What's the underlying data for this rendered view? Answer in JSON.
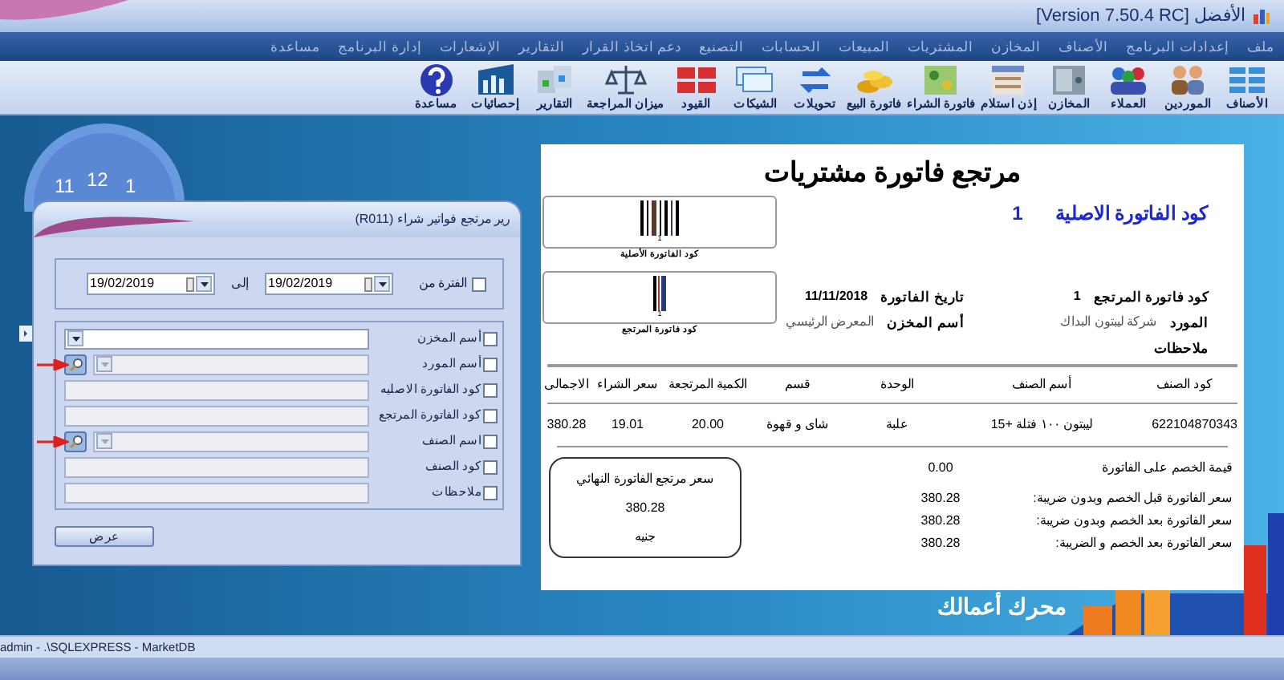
{
  "window": {
    "title": "[Version 7.50.4 RC] الأفضل"
  },
  "menu": [
    "ملف",
    "إعدادات البرنامج",
    "الأصناف",
    "المخازن",
    "المشتريات",
    "المبيعات",
    "الحسابات",
    "التصنيع",
    "دعم اتخاذ القرار",
    "التقارير",
    "الإشعارات",
    "إدارة البرنامج",
    "مساعدة"
  ],
  "toolbar": [
    "الأصناف",
    "الموردين",
    "العملاء",
    "المخازن",
    "إذن استلام",
    "فاتورة الشراء",
    "فاتورة البيع",
    "تحويلات",
    "الشيكات",
    "القيود",
    "ميزان المراجعة",
    "التقارير",
    "إحصائيات",
    "مساعدة"
  ],
  "clock_numbers": [
    "11",
    "12",
    "1"
  ],
  "dialog": {
    "title": "رير مرتجع فواتير شراء  (R011)",
    "period": {
      "label": "الفترة من",
      "checked": false,
      "from": "19/02/2019",
      "to_label": "إلى",
      "to": "19/02/2019"
    },
    "filters": [
      {
        "label": "أسم المخزن",
        "checked": false,
        "kind": "dropdown",
        "marked": false
      },
      {
        "label": "أسم المورد",
        "checked": false,
        "kind": "lookup",
        "marked": true
      },
      {
        "label": "كود الفاتورة الاصليه",
        "checked": false,
        "kind": "text",
        "marked": false
      },
      {
        "label": "كود الفاتورة المرتجع",
        "checked": false,
        "kind": "text",
        "marked": false
      },
      {
        "label": "اسم الصنف",
        "checked": false,
        "kind": "lookup",
        "marked": true
      },
      {
        "label": "كود الصنف",
        "checked": false,
        "kind": "text",
        "marked": false
      },
      {
        "label": "ملاحظات",
        "checked": false,
        "kind": "text",
        "marked": false
      }
    ],
    "button": "عرض"
  },
  "report": {
    "title": "مرتجع فاتورة مشتريات",
    "original_code": {
      "label": "كود الفاتورة الاصلية",
      "value": "1"
    },
    "barcodes": [
      {
        "number": "1",
        "caption": "كود الفاتورة الأصلية"
      },
      {
        "number": "1",
        "caption": "كود فاتورة المرتجع"
      }
    ],
    "fields": [
      [
        {
          "label": "كود فاتورة المرتجع",
          "value": "1"
        },
        {
          "label": "تاريخ الفاتورة",
          "value": "11/11/2018"
        }
      ],
      [
        {
          "label": "المورد",
          "value": "شركة ليبتون البداك"
        },
        {
          "label": "أسم المخزن",
          "value": "المعرض الرئيسي"
        }
      ],
      [
        {
          "label": "ملاحظات"
        }
      ]
    ],
    "table": {
      "columns": [
        "كود الصنف",
        "أسم الصنف",
        "الوحدة",
        "قسم",
        "الكمية المرتجعة",
        "سعر الشراء",
        "الاجمالى"
      ],
      "rows": [
        [
          "622104870343",
          "ليبتون ١٠٠ فتلة +15",
          "علبة",
          "شاى و قهوة",
          "20.00",
          "19.01",
          "380.28"
        ]
      ]
    },
    "summary": [
      {
        "label": "قيمة الخصم على الفاتورة",
        "value": "0.00"
      },
      {
        "label": "سعر الفاتورة قبل الخصم وبدون ضريبة:",
        "value": "380.28"
      },
      {
        "label": "سعر الفاتورة بعد الخصم وبدون ضريبة:",
        "value": "380.28"
      },
      {
        "label": "سعر الفاتورة بعد الخصم و الضريبة:",
        "value": "380.28"
      }
    ],
    "total_box": {
      "label": "سعر مرتجع الفاتورة النهائي",
      "value": "380.28",
      "currency": "جنيه"
    }
  },
  "banner": "محرك أعمالك",
  "status_bar": "admin - .\\SQLEXPRESS - MarketDB"
}
